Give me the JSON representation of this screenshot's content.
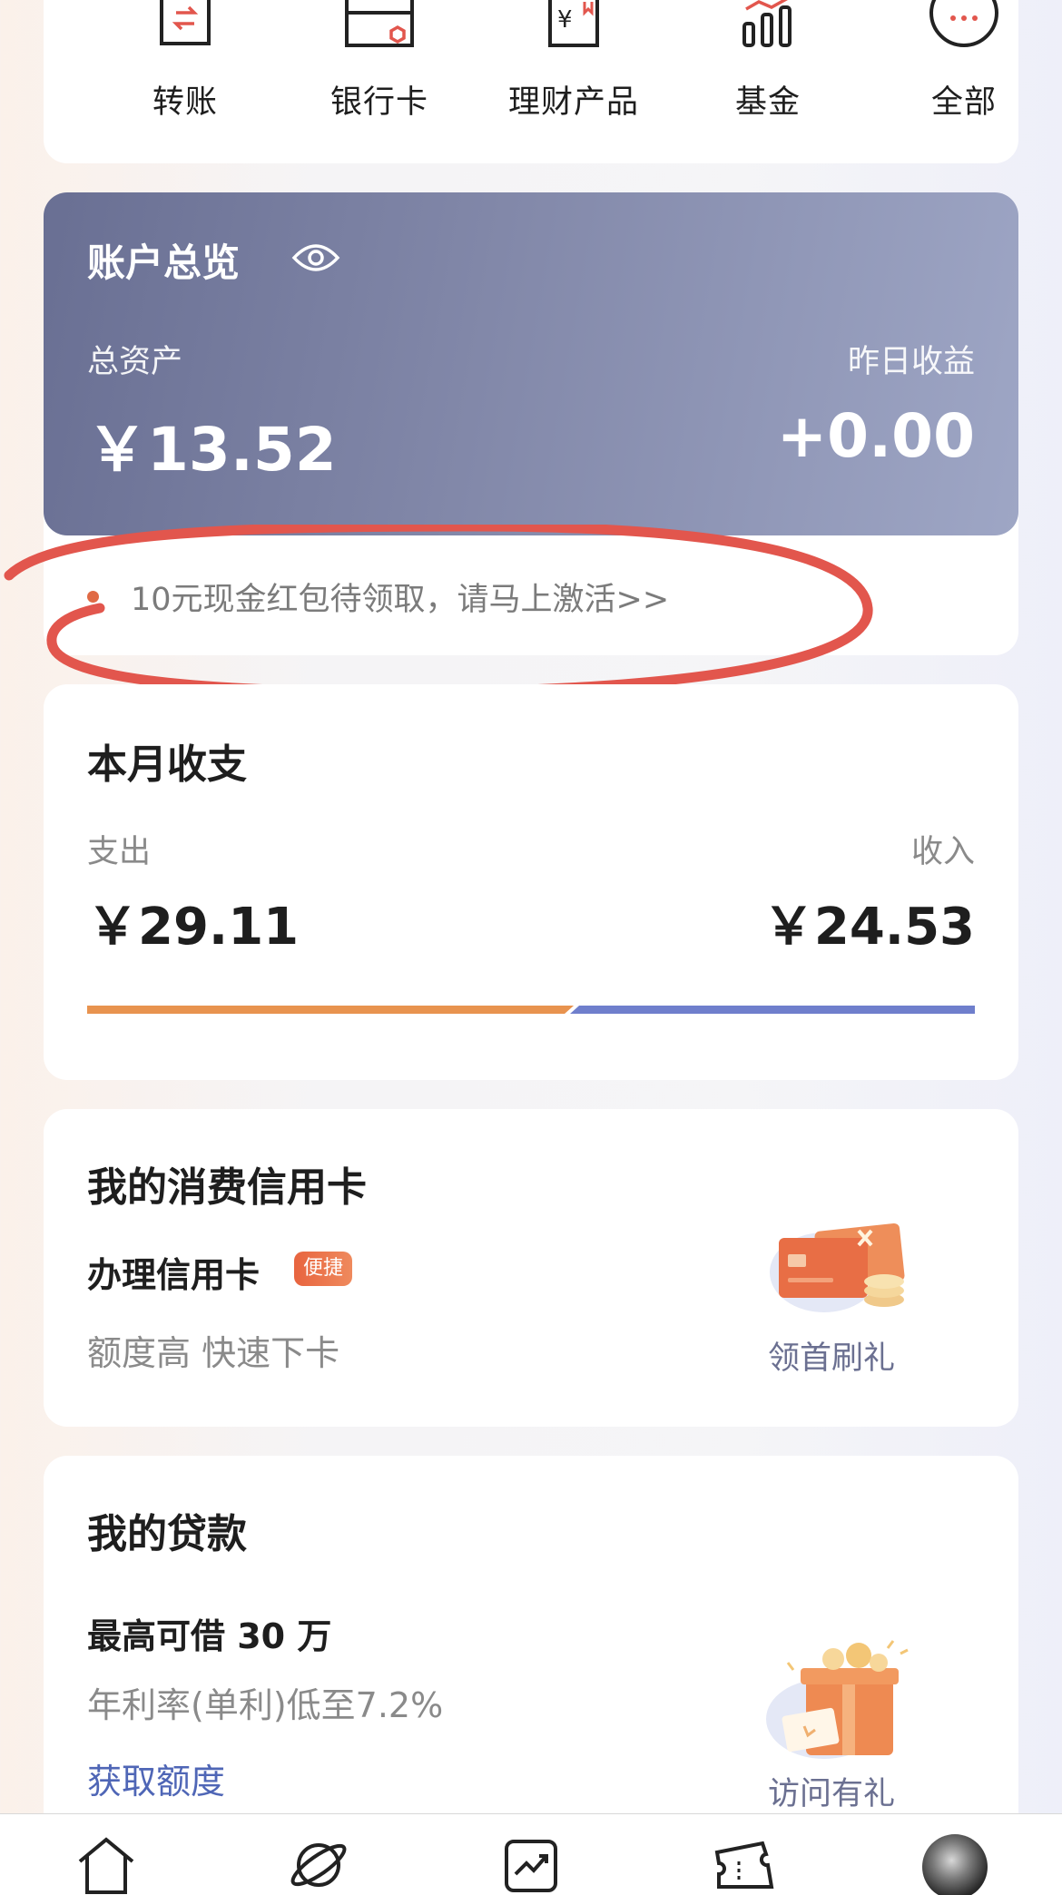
{
  "quick_menu": {
    "items": [
      {
        "label": "转账",
        "icon": "transfer-icon"
      },
      {
        "label": "银行卡",
        "icon": "bank-card-icon"
      },
      {
        "label": "理财产品",
        "icon": "wealth-product-icon"
      },
      {
        "label": "基金",
        "icon": "fund-chart-icon"
      },
      {
        "label": "全部",
        "icon": "more-icon"
      }
    ]
  },
  "overview": {
    "title": "账户总览",
    "eye_icon": "eye-icon",
    "total_assets_label": "总资产",
    "total_assets_value": "￥13.52",
    "yesterday_income_label": "昨日收益",
    "yesterday_income_value": "+0.00",
    "promo_text": "10元现金红包待领取，请马上激活>>"
  },
  "monthly": {
    "title": "本月收支",
    "expense_label": "支出",
    "expense_value": "￥29.11",
    "income_label": "收入",
    "income_value": "￥24.53",
    "expense_share": 0.543
  },
  "credit_card": {
    "title": "我的消费信用卡",
    "subtitle": "办理信用卡",
    "badge": "便捷",
    "description": "额度高 快速下卡",
    "gift_label": "领首刷礼"
  },
  "loan": {
    "title": "我的贷款",
    "max_amount": "最高可借 30 万",
    "rate": "年利率(单利)低至7.2%",
    "link": "获取额度",
    "gift_label": "访问有礼"
  },
  "bottom_nav": {
    "items": [
      "home-icon",
      "planet-icon",
      "trend-chart-icon",
      "ticket-icon",
      "avatar"
    ]
  },
  "colors": {
    "accent_red": "#e2564d",
    "expense_bar": "#e8934f",
    "income_bar": "#6f7fcc",
    "link_blue": "#4f66b6"
  }
}
